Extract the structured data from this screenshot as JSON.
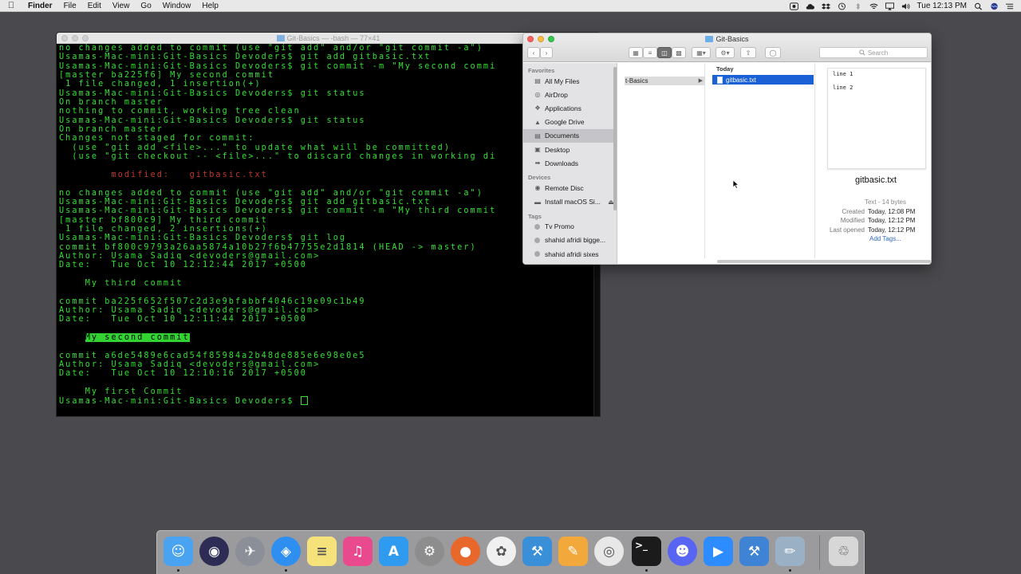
{
  "menubar": {
    "app_name": "Finder",
    "items": [
      "File",
      "Edit",
      "View",
      "Go",
      "Window",
      "Help"
    ],
    "clock": "Tue 12:13 PM"
  },
  "terminal": {
    "title": "Git-Basics — -bash — 77×41",
    "lines": [
      {
        "text": "no changes added to commit (use \"git add\" and/or \"git commit -a\")",
        "style": "normal"
      },
      {
        "text": "Usamas-Mac-mini:Git-Basics Devoders$ git add gitbasic.txt",
        "style": "normal"
      },
      {
        "text": "Usamas-Mac-mini:Git-Basics Devoders$ git commit -m \"My second commi",
        "style": "normal"
      },
      {
        "text": "[master ba225f6] My second commit",
        "style": "normal"
      },
      {
        "text": " 1 file changed, 1 insertion(+)",
        "style": "normal"
      },
      {
        "text": "Usamas-Mac-mini:Git-Basics Devoders$ git status",
        "style": "normal"
      },
      {
        "text": "On branch master",
        "style": "normal"
      },
      {
        "text": "nothing to commit, working tree clean",
        "style": "normal"
      },
      {
        "text": "Usamas-Mac-mini:Git-Basics Devoders$ git status",
        "style": "normal"
      },
      {
        "text": "On branch master",
        "style": "normal"
      },
      {
        "text": "Changes not staged for commit:",
        "style": "normal"
      },
      {
        "text": "  (use \"git add <file>...\" to update what will be committed)",
        "style": "normal"
      },
      {
        "text": "  (use \"git checkout -- <file>...\" to discard changes in working di",
        "style": "normal"
      },
      {
        "text": "",
        "style": "normal"
      },
      {
        "text": "        modified:   gitbasic.txt",
        "style": "red"
      },
      {
        "text": "",
        "style": "normal"
      },
      {
        "text": "no changes added to commit (use \"git add\" and/or \"git commit -a\")",
        "style": "normal"
      },
      {
        "text": "Usamas-Mac-mini:Git-Basics Devoders$ git add gitbasic.txt",
        "style": "normal"
      },
      {
        "text": "Usamas-Mac-mini:Git-Basics Devoders$ git commit -m \"My third commit",
        "style": "normal"
      },
      {
        "text": "[master bf800c9] My third commit",
        "style": "normal"
      },
      {
        "text": " 1 file changed, 2 insertions(+)",
        "style": "normal"
      },
      {
        "text": "Usamas-Mac-mini:Git-Basics Devoders$ git log",
        "style": "normal"
      },
      {
        "text": "commit bf800c9793a26aa5874a10b27f6b47755e2d1814 (HEAD -> master)",
        "style": "normal"
      },
      {
        "text": "Author: Usama Sadiq <devoders@gmail.com>",
        "style": "normal"
      },
      {
        "text": "Date:   Tue Oct 10 12:12:44 2017 +0500",
        "style": "normal"
      },
      {
        "text": "",
        "style": "normal"
      },
      {
        "text": "    My third commit",
        "style": "normal"
      },
      {
        "text": "",
        "style": "normal"
      },
      {
        "text": "commit ba225f652f507c2d3e9bfabbf4046c19e09c1b49",
        "style": "normal"
      },
      {
        "text": "Author: Usama Sadiq <devoders@gmail.com>",
        "style": "normal"
      },
      {
        "text": "Date:   Tue Oct 10 12:11:44 2017 +0500",
        "style": "normal"
      },
      {
        "text": "",
        "style": "normal"
      },
      {
        "text": "    ",
        "highlight": "My second commit",
        "style": "normal"
      },
      {
        "text": "",
        "style": "normal"
      },
      {
        "text": "commit a6de5489e6cad54f85984a2b48de885e6e98e0e5",
        "style": "normal"
      },
      {
        "text": "Author: Usama Sadiq <devoders@gmail.com>",
        "style": "normal"
      },
      {
        "text": "Date:   Tue Oct 10 12:10:16 2017 +0500",
        "style": "normal"
      },
      {
        "text": "",
        "style": "normal"
      },
      {
        "text": "    My first Commit",
        "style": "normal"
      },
      {
        "text": "Usamas-Mac-mini:Git-Basics Devoders$ ",
        "style": "prompt"
      }
    ]
  },
  "finder": {
    "title": "Git-Basics",
    "search_placeholder": "Search",
    "sidebar": {
      "favorites_header": "Favorites",
      "favorites": [
        {
          "label": "All My Files",
          "icon": "all-files-icon"
        },
        {
          "label": "AirDrop",
          "icon": "airdrop-icon"
        },
        {
          "label": "Applications",
          "icon": "applications-icon"
        },
        {
          "label": "Google Drive",
          "icon": "google-drive-icon"
        },
        {
          "label": "Documents",
          "icon": "documents-icon",
          "selected": true
        },
        {
          "label": "Desktop",
          "icon": "desktop-icon"
        },
        {
          "label": "Downloads",
          "icon": "downloads-icon"
        }
      ],
      "devices_header": "Devices",
      "devices": [
        {
          "label": "Remote Disc",
          "icon": "remote-disc-icon"
        },
        {
          "label": "Install macOS Si...",
          "icon": "disk-icon"
        }
      ],
      "tags_header": "Tags",
      "tags": [
        {
          "label": "Tv Promo"
        },
        {
          "label": "shahid afridi bigge..."
        },
        {
          "label": "shahid afridi sixes"
        }
      ]
    },
    "column1_item": "t-Basics",
    "column2_header": "Today",
    "column2_item": "gitbasic.txt",
    "preview": {
      "lines": [
        "line 1",
        "line 2"
      ],
      "filename": "gitbasic.txt",
      "kind": "Text - 14 bytes",
      "created_label": "Created",
      "created": "Today, 12:08 PM",
      "modified_label": "Modified",
      "modified": "Today, 12:12 PM",
      "last_opened_label": "Last opened",
      "last_opened": "Today, 12:12 PM",
      "add_tags": "Add Tags..."
    }
  },
  "dock": {
    "apps": [
      {
        "name": "Finder",
        "icon": "finder-icon",
        "color": "#4aa3f0",
        "running": true
      },
      {
        "name": "Siri",
        "icon": "siri-icon",
        "color": "#2c2c54",
        "running": false
      },
      {
        "name": "Launchpad",
        "icon": "launchpad-icon",
        "color": "#8a8f98",
        "running": false
      },
      {
        "name": "Safari",
        "icon": "safari-icon",
        "color": "#2f8ff0",
        "running": true
      },
      {
        "name": "Notes",
        "icon": "notes-icon",
        "color": "#f5e27a",
        "running": false
      },
      {
        "name": "iTunes",
        "icon": "itunes-icon",
        "color": "#e94a8e",
        "running": false
      },
      {
        "name": "App Store",
        "icon": "app-store-icon",
        "color": "#2e9bf0",
        "running": false
      },
      {
        "name": "System Preferences",
        "icon": "system-preferences-icon",
        "color": "#8d8d8d",
        "running": false
      },
      {
        "name": "Firefox",
        "icon": "firefox-icon",
        "color": "#e8672b",
        "running": false
      },
      {
        "name": "Photos",
        "icon": "photos-icon",
        "color": "#f0f0f0",
        "running": false
      },
      {
        "name": "Xcode",
        "icon": "xcode-icon",
        "color": "#3a8fd9",
        "running": false
      },
      {
        "name": "Pages",
        "icon": "pages-icon",
        "color": "#f3a83b",
        "running": false
      },
      {
        "name": "Chrome",
        "icon": "chrome-icon",
        "color": "#e7e7e7",
        "running": false
      },
      {
        "name": "Terminal",
        "icon": "terminal-icon",
        "color": "#1b1b1b",
        "running": true
      },
      {
        "name": "Discord",
        "icon": "discord-icon",
        "color": "#5865f2",
        "running": false
      },
      {
        "name": "Zoom",
        "icon": "zoom-icon",
        "color": "#2d8cff",
        "running": false
      },
      {
        "name": "Xcode Beta",
        "icon": "xcode-beta-icon",
        "color": "#3f84d4",
        "running": false
      },
      {
        "name": "Brushes",
        "icon": "brushes-icon",
        "color": "#9ab0c4",
        "running": true
      },
      {
        "name": "Trash",
        "icon": "trash-icon",
        "color": "#d7d7d7",
        "running": false
      }
    ]
  }
}
